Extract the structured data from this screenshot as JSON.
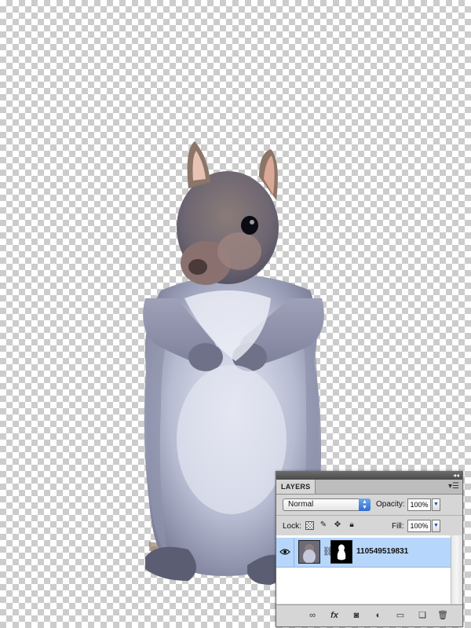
{
  "canvas": {
    "subject": "squirrel-photo-transparent-bg"
  },
  "panel": {
    "tab_label": "LAYERS",
    "blend_mode": "Normal",
    "opacity_label": "Opacity:",
    "opacity_value": "100%",
    "lock_label": "Lock:",
    "fill_label": "Fill:",
    "fill_value": "100%",
    "layers": [
      {
        "name": "110549519831",
        "visible": true,
        "selected": true
      }
    ]
  },
  "icons": {
    "collapse": "double-arrow-collapse-icon",
    "menu": "panel-menu-icon",
    "eye": "eye-icon",
    "link": "chain-link-icon",
    "toolbar": [
      "link-layers-icon",
      "fx-icon",
      "add-mask-icon",
      "adjustment-layer-icon",
      "new-group-icon",
      "new-layer-icon",
      "trash-icon"
    ]
  },
  "colors": {
    "selected_row": "#b6d6fb",
    "select_accent": "#2f6fd0"
  }
}
